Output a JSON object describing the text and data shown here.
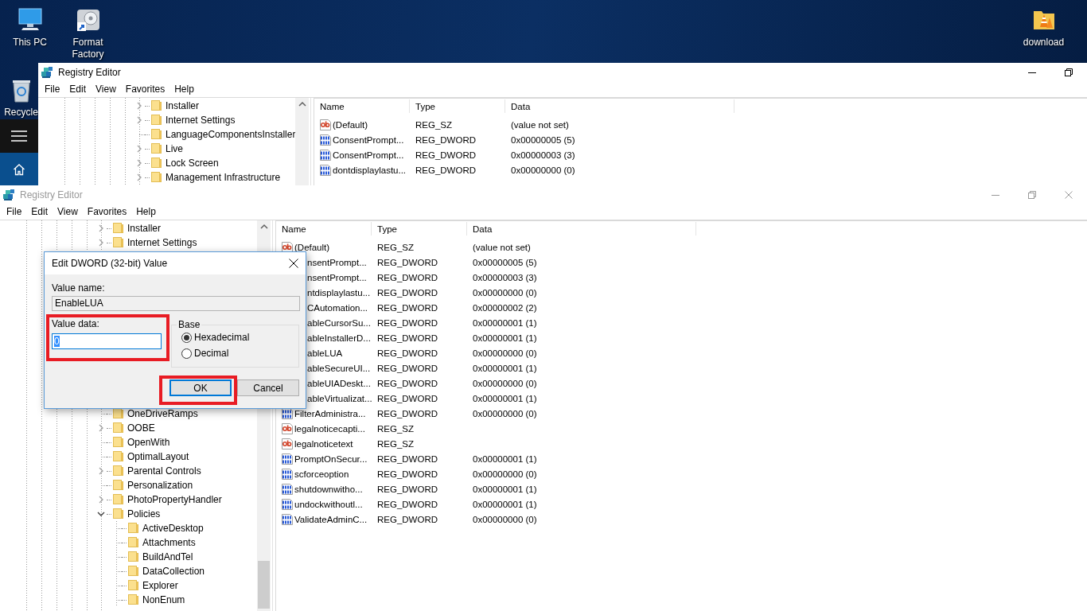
{
  "desktop": {
    "icons": [
      {
        "label": "This PC",
        "kind": "pc"
      },
      {
        "label": "Format Factory",
        "kind": "app"
      },
      {
        "label": "download",
        "kind": "folder"
      },
      {
        "label": "Recycle",
        "kind": "bin"
      }
    ]
  },
  "windows": [
    {
      "title": "Registry Editor",
      "active": true,
      "title_buttons": [
        {
          "kind": "minimize"
        },
        {
          "kind": "restore"
        }
      ],
      "menu": [
        "File",
        "Edit",
        "View",
        "Favorites",
        "Help"
      ],
      "tree": [
        {
          "label": "Installer",
          "expandable": true,
          "expanded": false
        },
        {
          "label": "Internet Settings",
          "expandable": true,
          "expanded": false
        },
        {
          "label": "LanguageComponentsInstaller",
          "expandable": false
        },
        {
          "label": "Live",
          "expandable": true,
          "expanded": false
        },
        {
          "label": "Lock Screen",
          "expandable": true,
          "expanded": false
        },
        {
          "label": "Management Infrastructure",
          "expandable": true,
          "expanded": false
        }
      ],
      "columns": [
        "Name",
        "Type",
        "Data"
      ],
      "rows": [
        {
          "kind": "sz",
          "name": "(Default)",
          "type": "REG_SZ",
          "data": "(value not set)"
        },
        {
          "kind": "dword",
          "name": "ConsentPrompt...",
          "type": "REG_DWORD",
          "data": "0x00000005 (5)"
        },
        {
          "kind": "dword",
          "name": "ConsentPrompt...",
          "type": "REG_DWORD",
          "data": "0x00000003 (3)"
        },
        {
          "kind": "dword",
          "name": "dontdisplaylastu...",
          "type": "REG_DWORD",
          "data": "0x00000000 (0)"
        }
      ]
    },
    {
      "title": "Registry Editor",
      "active": false,
      "title_buttons": [
        {
          "kind": "minimize"
        },
        {
          "kind": "restore"
        },
        {
          "kind": "close"
        }
      ],
      "menu": [
        "File",
        "Edit",
        "View",
        "Favorites",
        "Help"
      ],
      "tree": [
        {
          "label": "Installer",
          "expandable": true,
          "expanded": false
        },
        {
          "label": "Internet Settings",
          "expandable": true,
          "expanded": false
        }
      ],
      "tree_lower": [
        {
          "label": "OneDriveRamps",
          "expandable": false
        },
        {
          "label": "OOBE",
          "expandable": true,
          "expanded": false
        },
        {
          "label": "OpenWith",
          "expandable": false
        },
        {
          "label": "OptimalLayout",
          "expandable": false
        },
        {
          "label": "Parental Controls",
          "expandable": true,
          "expanded": false
        },
        {
          "label": "Personalization",
          "expandable": false
        },
        {
          "label": "PhotoPropertyHandler",
          "expandable": true,
          "expanded": false
        },
        {
          "label": "Policies",
          "expandable": true,
          "expanded": true,
          "children": [
            {
              "label": "ActiveDesktop",
              "expandable": false
            },
            {
              "label": "Attachments",
              "expandable": false
            },
            {
              "label": "BuildAndTel",
              "expandable": false
            },
            {
              "label": "DataCollection",
              "expandable": false
            },
            {
              "label": "Explorer",
              "expandable": false
            },
            {
              "label": "NonEnum",
              "expandable": false
            }
          ]
        }
      ],
      "columns": [
        "Name",
        "Type",
        "Data"
      ],
      "rows": [
        {
          "kind": "sz",
          "name": "(Default)",
          "type": "REG_SZ",
          "data": "(value not set)"
        },
        {
          "name": "nsentPrompt...",
          "type": "REG_DWORD",
          "data": "0x00000005 (5)"
        },
        {
          "name": "nsentPrompt...",
          "type": "REG_DWORD",
          "data": "0x00000003 (3)"
        },
        {
          "name": "ntdisplaylastu...",
          "type": "REG_DWORD",
          "data": "0x00000000 (0)"
        },
        {
          "name": "CAutomation...",
          "type": "REG_DWORD",
          "data": "0x00000002 (2)"
        },
        {
          "name": "ableCursorSu...",
          "type": "REG_DWORD",
          "data": "0x00000001 (1)"
        },
        {
          "name": "ableInstallerD...",
          "type": "REG_DWORD",
          "data": "0x00000001 (1)"
        },
        {
          "name": "ableLUA",
          "type": "REG_DWORD",
          "data": "0x00000000 (0)"
        },
        {
          "name": "ableSecureUI...",
          "type": "REG_DWORD",
          "data": "0x00000001 (1)"
        },
        {
          "name": "ableUIADeskt...",
          "type": "REG_DWORD",
          "data": "0x00000000 (0)"
        },
        {
          "name": "ableVirtualizat...",
          "type": "REG_DWORD",
          "data": "0x00000001 (1)"
        },
        {
          "kind": "dword",
          "name": "FilterAdministra...",
          "type": "REG_DWORD",
          "data": "0x00000000 (0)"
        },
        {
          "kind": "sz",
          "name": "legalnoticecapti...",
          "type": "REG_SZ"
        },
        {
          "kind": "sz",
          "name": "legalnoticetext",
          "type": "REG_SZ"
        },
        {
          "kind": "dword",
          "name": "PromptOnSecur...",
          "type": "REG_DWORD",
          "data": "0x00000001 (1)"
        },
        {
          "kind": "dword",
          "name": "scforceoption",
          "type": "REG_DWORD",
          "data": "0x00000000 (0)"
        },
        {
          "kind": "dword",
          "name": "shutdownwitho...",
          "type": "REG_DWORD",
          "data": "0x00000001 (1)"
        },
        {
          "kind": "dword",
          "name": "undockwithoutl...",
          "type": "REG_DWORD",
          "data": "0x00000001 (1)"
        },
        {
          "kind": "dword",
          "name": "ValidateAdminC...",
          "type": "REG_DWORD",
          "data": "0x00000000 (0)"
        }
      ]
    }
  ],
  "dialog": {
    "title": "Edit DWORD (32-bit) Value",
    "value_name": {
      "label": "Value name:",
      "value": "EnableLUA"
    },
    "value_data": {
      "label": "Value data:",
      "value": "0",
      "highlighted": true
    },
    "base": {
      "label": "Base",
      "options": [
        {
          "label": "Hexadecimal",
          "selected": true
        },
        {
          "label": "Decimal",
          "selected": false
        }
      ]
    },
    "buttons": [
      {
        "label": "OK",
        "default": true,
        "highlighted": true
      },
      {
        "label": "Cancel",
        "default": false,
        "highlighted": false
      }
    ]
  }
}
